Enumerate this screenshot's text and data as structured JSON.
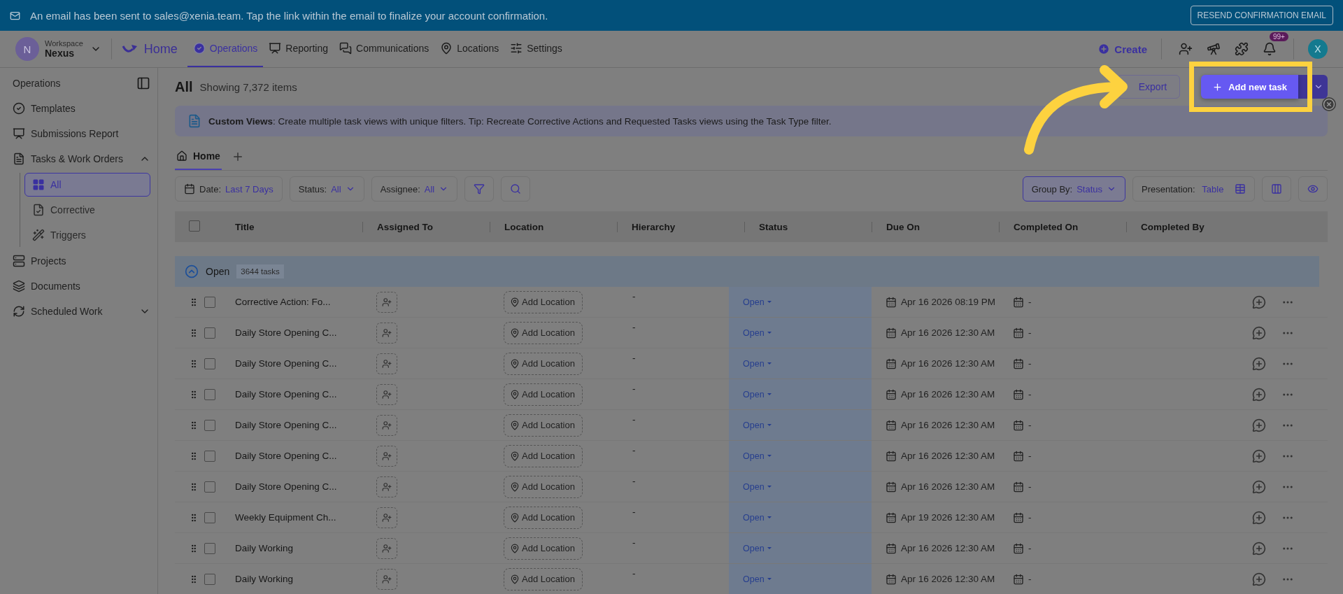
{
  "notice": {
    "text": "An email has been sent to sales@xenia.team. Tap the link within the email to finalize your account confirmation.",
    "button": "RESEND CONFIRMATION EMAIL"
  },
  "nav": {
    "workspace_label": "Workspace",
    "workspace_name": "Nexus",
    "workspace_initial": "N",
    "home": "Home",
    "items": [
      {
        "label": "Operations",
        "selected": true
      },
      {
        "label": "Reporting",
        "selected": false
      },
      {
        "label": "Communications",
        "selected": false
      },
      {
        "label": "Locations",
        "selected": false
      },
      {
        "label": "Settings",
        "selected": false
      }
    ],
    "create": "Create",
    "badge": "99+",
    "user_initial": "X"
  },
  "sidebar": {
    "title": "Operations",
    "items": [
      {
        "label": "Templates",
        "kind": "link"
      },
      {
        "label": "Submissions Report",
        "kind": "link"
      },
      {
        "label": "Tasks & Work Orders",
        "kind": "group",
        "expanded": true,
        "children": [
          {
            "label": "All",
            "selected": true
          },
          {
            "label": "Corrective",
            "selected": false
          },
          {
            "label": "Triggers",
            "selected": false
          }
        ]
      },
      {
        "label": "Projects",
        "kind": "link"
      },
      {
        "label": "Documents",
        "kind": "link"
      },
      {
        "label": "Scheduled Work",
        "kind": "group",
        "expanded": false
      }
    ]
  },
  "header": {
    "title": "All",
    "count": "Showing 7,372 items",
    "export": "Export",
    "add": "Add new task"
  },
  "tip": {
    "text": "**Custom Views**: Create multiple task views with unique filters. Tip: Recreate Corrective Actions and Requested Tasks views using the Task Type filter."
  },
  "view_tabs": [
    {
      "label": "Home",
      "selected": true
    }
  ],
  "filters": [
    {
      "kind": "date",
      "label": "Date:",
      "value": "Last 7 Days"
    },
    {
      "kind": "select",
      "label": "Status:",
      "value": "All"
    },
    {
      "kind": "select",
      "label": "Assignee:",
      "value": "All"
    }
  ],
  "group_by": {
    "label": "Group By:",
    "value": "Status"
  },
  "presentation": {
    "label": "Presentation:",
    "value": "Table"
  },
  "table": {
    "all_checked": false,
    "columns": [
      "Title",
      "Assigned To",
      "Location",
      "Hierarchy",
      "Status",
      "Due On",
      "Completed On",
      "Completed By"
    ],
    "group": {
      "label": "Open",
      "count": "3644 tasks",
      "expanded": true
    },
    "rows": [
      {
        "title": "Corrective Action: Fo...",
        "location": "Add Location",
        "hierarchy": "-",
        "status": "Open",
        "due": "Apr 16 2026 08:19 PM",
        "completed": "-",
        "checked": false
      },
      {
        "title": "Daily Store Opening C...",
        "location": "Add Location",
        "hierarchy": "-",
        "status": "Open",
        "due": "Apr 16 2026 12:30 AM",
        "completed": "-",
        "checked": false
      },
      {
        "title": "Daily Store Opening C...",
        "location": "Add Location",
        "hierarchy": "-",
        "status": "Open",
        "due": "Apr 16 2026 12:30 AM",
        "completed": "-",
        "checked": false
      },
      {
        "title": "Daily Store Opening C...",
        "location": "Add Location",
        "hierarchy": "-",
        "status": "Open",
        "due": "Apr 16 2026 12:30 AM",
        "completed": "-",
        "checked": false
      },
      {
        "title": "Daily Store Opening C...",
        "location": "Add Location",
        "hierarchy": "-",
        "status": "Open",
        "due": "Apr 16 2026 12:30 AM",
        "completed": "-",
        "checked": false
      },
      {
        "title": "Daily Store Opening C...",
        "location": "Add Location",
        "hierarchy": "-",
        "status": "Open",
        "due": "Apr 16 2026 12:30 AM",
        "completed": "-",
        "checked": false
      },
      {
        "title": "Daily Store Opening C...",
        "location": "Add Location",
        "hierarchy": "-",
        "status": "Open",
        "due": "Apr 16 2026 12:30 AM",
        "completed": "-",
        "checked": false
      },
      {
        "title": "Weekly Equipment Ch...",
        "location": "Add Location",
        "hierarchy": "-",
        "status": "Open",
        "due": "Apr 19 2026 12:30 AM",
        "completed": "-",
        "checked": false
      },
      {
        "title": "Daily Working",
        "location": "Add Location",
        "hierarchy": "-",
        "status": "Open",
        "due": "Apr 16 2026 12:30 AM",
        "completed": "-",
        "checked": false
      },
      {
        "title": "Daily Working",
        "location": "Add Location",
        "hierarchy": "-",
        "status": "Open",
        "due": "Apr 16 2026 12:30 AM",
        "completed": "-",
        "checked": false
      }
    ]
  }
}
